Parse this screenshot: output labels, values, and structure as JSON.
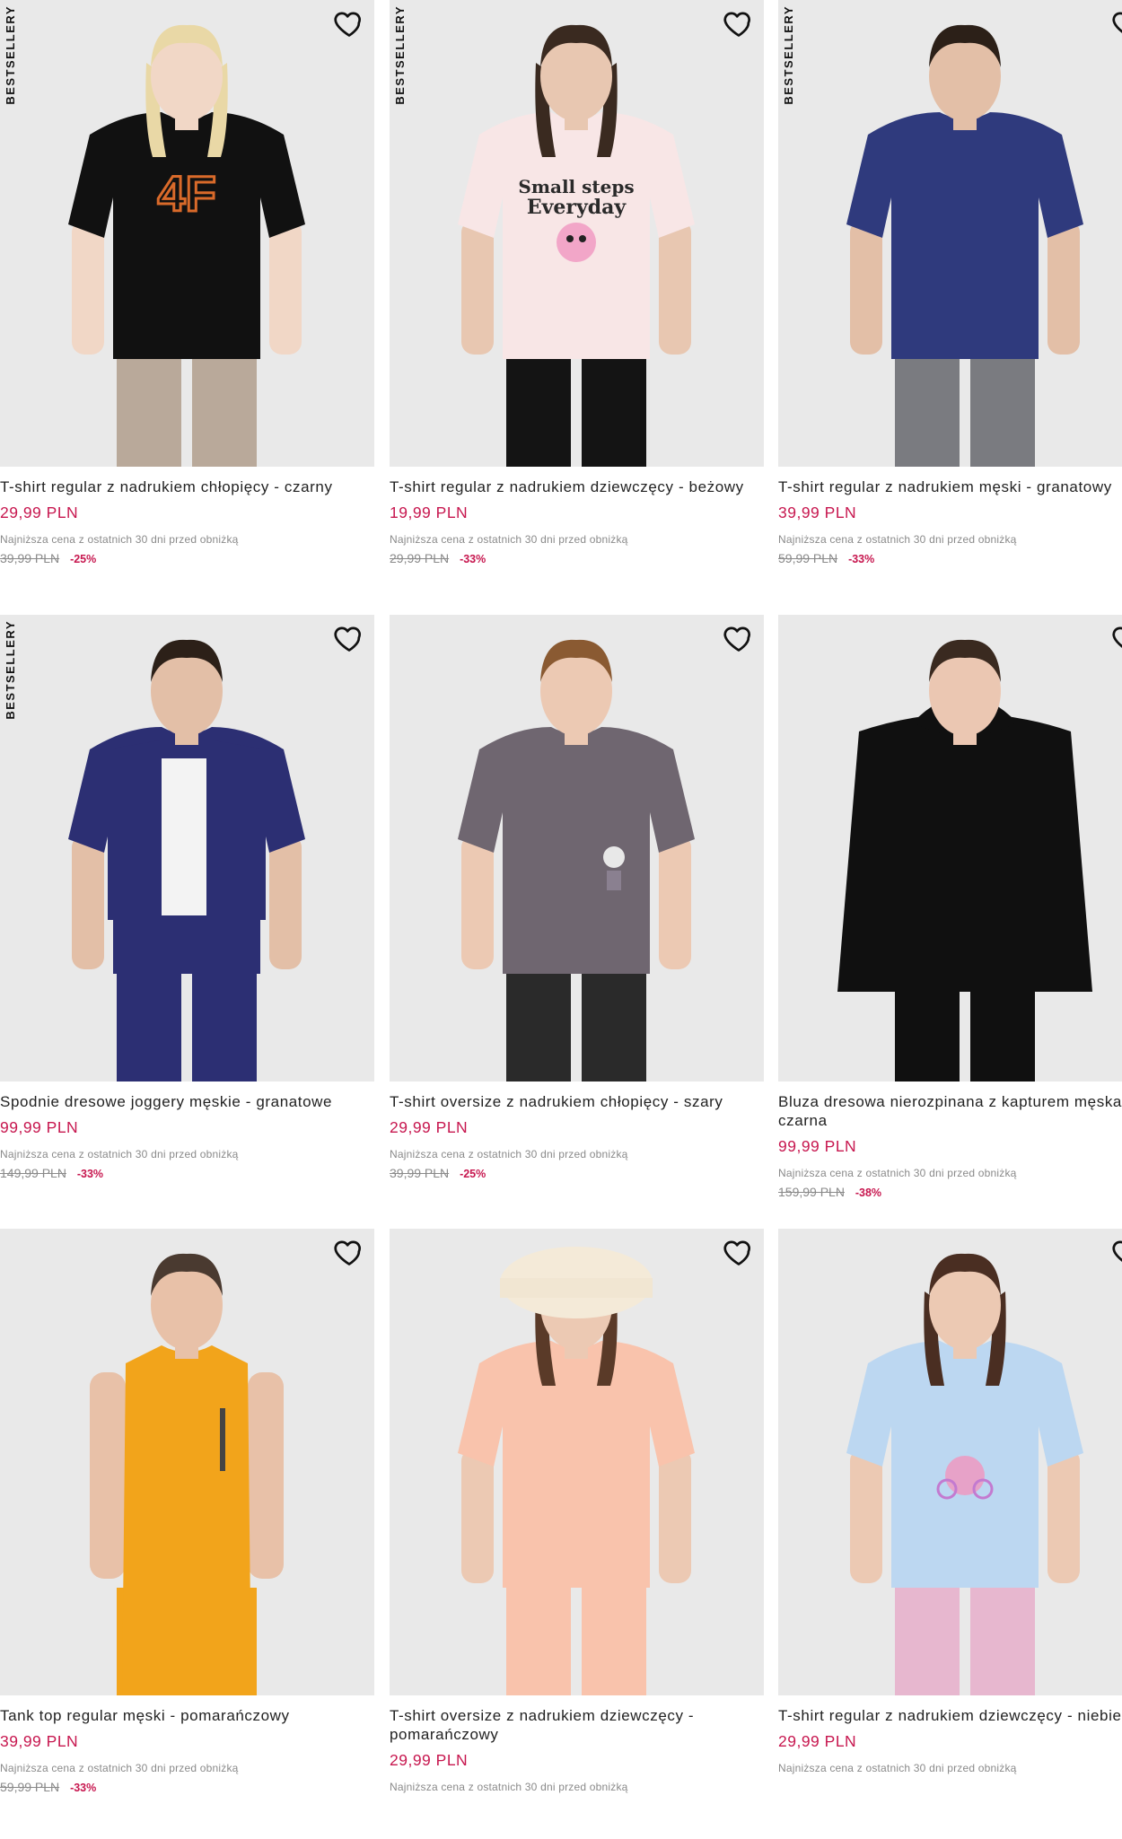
{
  "products": [
    {
      "badge": "BESTSELLERY",
      "title": "T-shirt regular z nadrukiem chłopięcy - czarny",
      "price": "29,99 PLN",
      "note": "Najniższa cena z ostatnich 30 dni przed obniżką",
      "old_price": "39,99 PLN",
      "discount": "-25%",
      "colors": {
        "skin": "#f1d7c6",
        "hair": "#e9d8a6",
        "top": "#111111",
        "bottom": "#b9a99a",
        "print": "#d96a2a"
      },
      "print_text": "4F"
    },
    {
      "badge": "BESTSELLERY",
      "title": "T-shirt regular z nadrukiem dziewczęcy - beżowy",
      "price": "19,99 PLN",
      "note": "Najniższa cena z ostatnich 30 dni przed obniżką",
      "old_price": "29,99 PLN",
      "discount": "-33%",
      "colors": {
        "skin": "#e8c7b1",
        "hair": "#3a2a20",
        "top": "#f8e6e6",
        "bottom": "#141414",
        "print": "#2a2a2a"
      },
      "print_text": "Small steps Everyday"
    },
    {
      "badge": "BESTSELLERY",
      "title": "T-shirt regular z nadrukiem męski - granatowy",
      "price": "39,99 PLN",
      "note": "Najniższa cena z ostatnich 30 dni przed obniżką",
      "old_price": "59,99 PLN",
      "discount": "-33%",
      "colors": {
        "skin": "#e3bfa7",
        "hair": "#2c2018",
        "top": "#2f3a7d",
        "bottom": "#7a7b80",
        "print": "#2f3a7d"
      },
      "print_text": ""
    },
    {
      "badge": "BESTSELLERY",
      "title": "Spodnie dresowe joggery męskie - granatowe",
      "price": "99,99 PLN",
      "note": "Najniższa cena z ostatnich 30 dni przed obniżką",
      "old_price": "149,99 PLN",
      "discount": "-33%",
      "colors": {
        "skin": "#e3bfa7",
        "hair": "#2c2018",
        "top": "#2c2f73",
        "bottom": "#2c2f73",
        "print": "#ffffff"
      },
      "print_text": ""
    },
    {
      "badge": "",
      "title": "T-shirt oversize z nadrukiem chłopięcy - szary",
      "price": "29,99 PLN",
      "note": "Najniższa cena z ostatnich 30 dni przed obniżką",
      "old_price": "39,99 PLN",
      "discount": "-25%",
      "colors": {
        "skin": "#ecc9b3",
        "hair": "#8a5a32",
        "top": "#6f6670",
        "bottom": "#2a2a2a",
        "print": "#e8e8e8"
      },
      "print_text": ""
    },
    {
      "badge": "",
      "title": "Bluza dresowa nierozpinana z kapturem męska - czarna",
      "price": "99,99 PLN",
      "note": "Najniższa cena z ostatnich 30 dni przed obniżką",
      "old_price": "159,99 PLN",
      "discount": "-38%",
      "colors": {
        "skin": "#ebc7b2",
        "hair": "#3a2a20",
        "top": "#101010",
        "bottom": "#101010",
        "print": "#101010"
      },
      "print_text": ""
    },
    {
      "badge": "",
      "title": "Tank top regular męski - pomarańczowy",
      "price": "39,99 PLN",
      "note": "Najniższa cena z ostatnich 30 dni przed obniżką",
      "old_price": "59,99 PLN",
      "discount": "-33%",
      "colors": {
        "skin": "#e8c1a8",
        "hair": "#4a3a30",
        "top": "#f2a41b",
        "bottom": "#f2a41b",
        "print": "#444444"
      },
      "print_text": ""
    },
    {
      "badge": "",
      "title": "T-shirt oversize z nadrukiem dziewczęcy - pomarańczowy",
      "price": "29,99 PLN",
      "note": "Najniższa cena z ostatnich 30 dni przed obniżką",
      "old_price": "",
      "discount": "",
      "colors": {
        "skin": "#ecc9b3",
        "hair": "#5a3a28",
        "top": "#f9c3ac",
        "bottom": "#f9c3ac",
        "print": "#f3d3c3"
      },
      "print_text": ""
    },
    {
      "badge": "",
      "title": "T-shirt regular z nadrukiem dziewczęcy - niebieski",
      "price": "29,99 PLN",
      "note": "Najniższa cena z ostatnich 30 dni przed obniżką",
      "old_price": "",
      "discount": "",
      "colors": {
        "skin": "#ecc9b3",
        "hair": "#4a2e22",
        "top": "#bcd7f1",
        "bottom": "#e7b7cf",
        "print": "#e7a2c8"
      },
      "print_text": ""
    }
  ]
}
